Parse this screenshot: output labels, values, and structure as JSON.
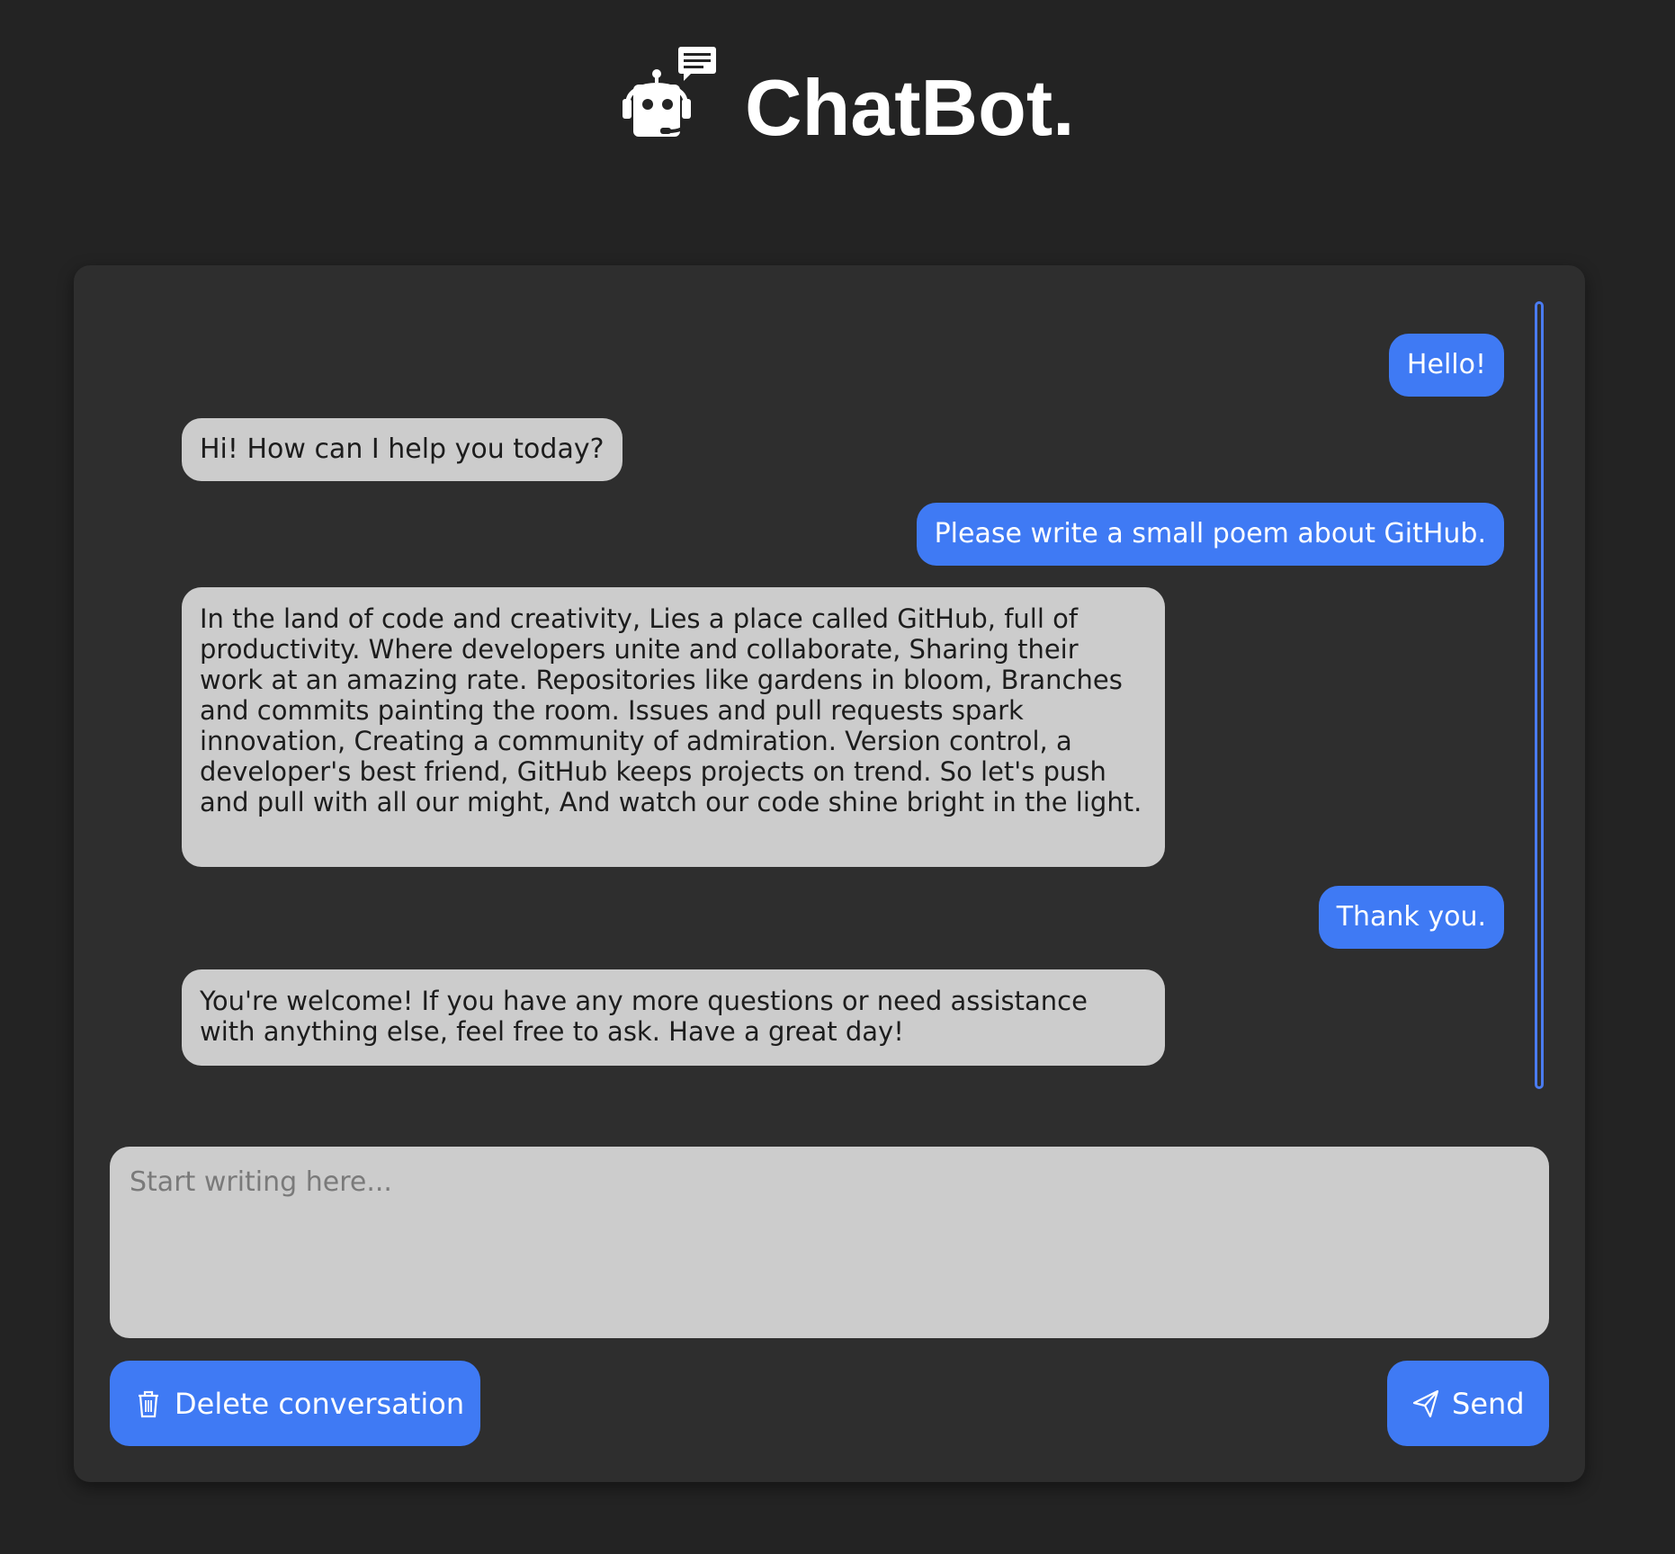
{
  "header": {
    "title": "ChatBot.",
    "logo_icon": "robot-headset-chat-icon"
  },
  "conversation": {
    "messages": [
      {
        "role": "user",
        "text": "Hello!"
      },
      {
        "role": "bot",
        "text": "Hi! How can I help you today?"
      },
      {
        "role": "user",
        "text": "Please write a small poem about GitHub."
      },
      {
        "role": "bot",
        "text": "In the land of code and creativity, Lies a place called GitHub, full of productivity. Where developers unite and collaborate, Sharing their work at an amazing rate. Repositories like gardens in bloom, Branches and commits painting the room. Issues and pull requests spark innovation, Creating a community of admiration. Version control, a developer's best friend, GitHub keeps projects on trend. So let's push and pull with all our might, And watch our code shine bright in the light."
      },
      {
        "role": "user",
        "text": "Thank you."
      },
      {
        "role": "bot",
        "text": "You're welcome! If you have any more questions or need assistance with anything else, feel free to ask. Have a great day!"
      }
    ]
  },
  "composer": {
    "placeholder": "Start writing here...",
    "value": ""
  },
  "actions": {
    "delete_label": "Delete conversation",
    "delete_icon": "trash-icon",
    "send_label": "Send",
    "send_icon": "paper-plane-icon"
  },
  "colors": {
    "background": "#232323",
    "panel": "#2e2e2e",
    "accent": "#3f7af4",
    "bot_bubble": "#cccccc"
  }
}
